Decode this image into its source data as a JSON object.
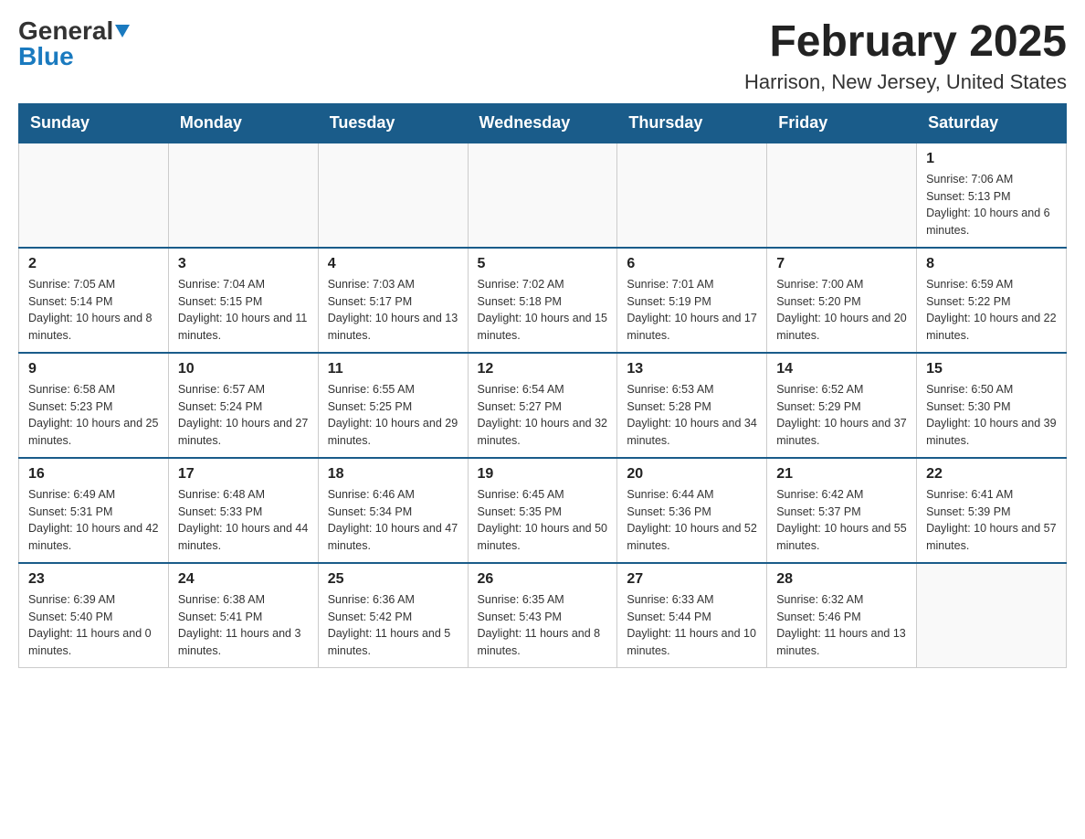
{
  "header": {
    "title": "February 2025",
    "subtitle": "Harrison, New Jersey, United States",
    "logo_general": "General",
    "logo_blue": "Blue"
  },
  "days_of_week": [
    "Sunday",
    "Monday",
    "Tuesday",
    "Wednesday",
    "Thursday",
    "Friday",
    "Saturday"
  ],
  "weeks": [
    [
      {
        "day": "",
        "info": ""
      },
      {
        "day": "",
        "info": ""
      },
      {
        "day": "",
        "info": ""
      },
      {
        "day": "",
        "info": ""
      },
      {
        "day": "",
        "info": ""
      },
      {
        "day": "",
        "info": ""
      },
      {
        "day": "1",
        "info": "Sunrise: 7:06 AM\nSunset: 5:13 PM\nDaylight: 10 hours and 6 minutes."
      }
    ],
    [
      {
        "day": "2",
        "info": "Sunrise: 7:05 AM\nSunset: 5:14 PM\nDaylight: 10 hours and 8 minutes."
      },
      {
        "day": "3",
        "info": "Sunrise: 7:04 AM\nSunset: 5:15 PM\nDaylight: 10 hours and 11 minutes."
      },
      {
        "day": "4",
        "info": "Sunrise: 7:03 AM\nSunset: 5:17 PM\nDaylight: 10 hours and 13 minutes."
      },
      {
        "day": "5",
        "info": "Sunrise: 7:02 AM\nSunset: 5:18 PM\nDaylight: 10 hours and 15 minutes."
      },
      {
        "day": "6",
        "info": "Sunrise: 7:01 AM\nSunset: 5:19 PM\nDaylight: 10 hours and 17 minutes."
      },
      {
        "day": "7",
        "info": "Sunrise: 7:00 AM\nSunset: 5:20 PM\nDaylight: 10 hours and 20 minutes."
      },
      {
        "day": "8",
        "info": "Sunrise: 6:59 AM\nSunset: 5:22 PM\nDaylight: 10 hours and 22 minutes."
      }
    ],
    [
      {
        "day": "9",
        "info": "Sunrise: 6:58 AM\nSunset: 5:23 PM\nDaylight: 10 hours and 25 minutes."
      },
      {
        "day": "10",
        "info": "Sunrise: 6:57 AM\nSunset: 5:24 PM\nDaylight: 10 hours and 27 minutes."
      },
      {
        "day": "11",
        "info": "Sunrise: 6:55 AM\nSunset: 5:25 PM\nDaylight: 10 hours and 29 minutes."
      },
      {
        "day": "12",
        "info": "Sunrise: 6:54 AM\nSunset: 5:27 PM\nDaylight: 10 hours and 32 minutes."
      },
      {
        "day": "13",
        "info": "Sunrise: 6:53 AM\nSunset: 5:28 PM\nDaylight: 10 hours and 34 minutes."
      },
      {
        "day": "14",
        "info": "Sunrise: 6:52 AM\nSunset: 5:29 PM\nDaylight: 10 hours and 37 minutes."
      },
      {
        "day": "15",
        "info": "Sunrise: 6:50 AM\nSunset: 5:30 PM\nDaylight: 10 hours and 39 minutes."
      }
    ],
    [
      {
        "day": "16",
        "info": "Sunrise: 6:49 AM\nSunset: 5:31 PM\nDaylight: 10 hours and 42 minutes."
      },
      {
        "day": "17",
        "info": "Sunrise: 6:48 AM\nSunset: 5:33 PM\nDaylight: 10 hours and 44 minutes."
      },
      {
        "day": "18",
        "info": "Sunrise: 6:46 AM\nSunset: 5:34 PM\nDaylight: 10 hours and 47 minutes."
      },
      {
        "day": "19",
        "info": "Sunrise: 6:45 AM\nSunset: 5:35 PM\nDaylight: 10 hours and 50 minutes."
      },
      {
        "day": "20",
        "info": "Sunrise: 6:44 AM\nSunset: 5:36 PM\nDaylight: 10 hours and 52 minutes."
      },
      {
        "day": "21",
        "info": "Sunrise: 6:42 AM\nSunset: 5:37 PM\nDaylight: 10 hours and 55 minutes."
      },
      {
        "day": "22",
        "info": "Sunrise: 6:41 AM\nSunset: 5:39 PM\nDaylight: 10 hours and 57 minutes."
      }
    ],
    [
      {
        "day": "23",
        "info": "Sunrise: 6:39 AM\nSunset: 5:40 PM\nDaylight: 11 hours and 0 minutes."
      },
      {
        "day": "24",
        "info": "Sunrise: 6:38 AM\nSunset: 5:41 PM\nDaylight: 11 hours and 3 minutes."
      },
      {
        "day": "25",
        "info": "Sunrise: 6:36 AM\nSunset: 5:42 PM\nDaylight: 11 hours and 5 minutes."
      },
      {
        "day": "26",
        "info": "Sunrise: 6:35 AM\nSunset: 5:43 PM\nDaylight: 11 hours and 8 minutes."
      },
      {
        "day": "27",
        "info": "Sunrise: 6:33 AM\nSunset: 5:44 PM\nDaylight: 11 hours and 10 minutes."
      },
      {
        "day": "28",
        "info": "Sunrise: 6:32 AM\nSunset: 5:46 PM\nDaylight: 11 hours and 13 minutes."
      },
      {
        "day": "",
        "info": ""
      }
    ]
  ]
}
